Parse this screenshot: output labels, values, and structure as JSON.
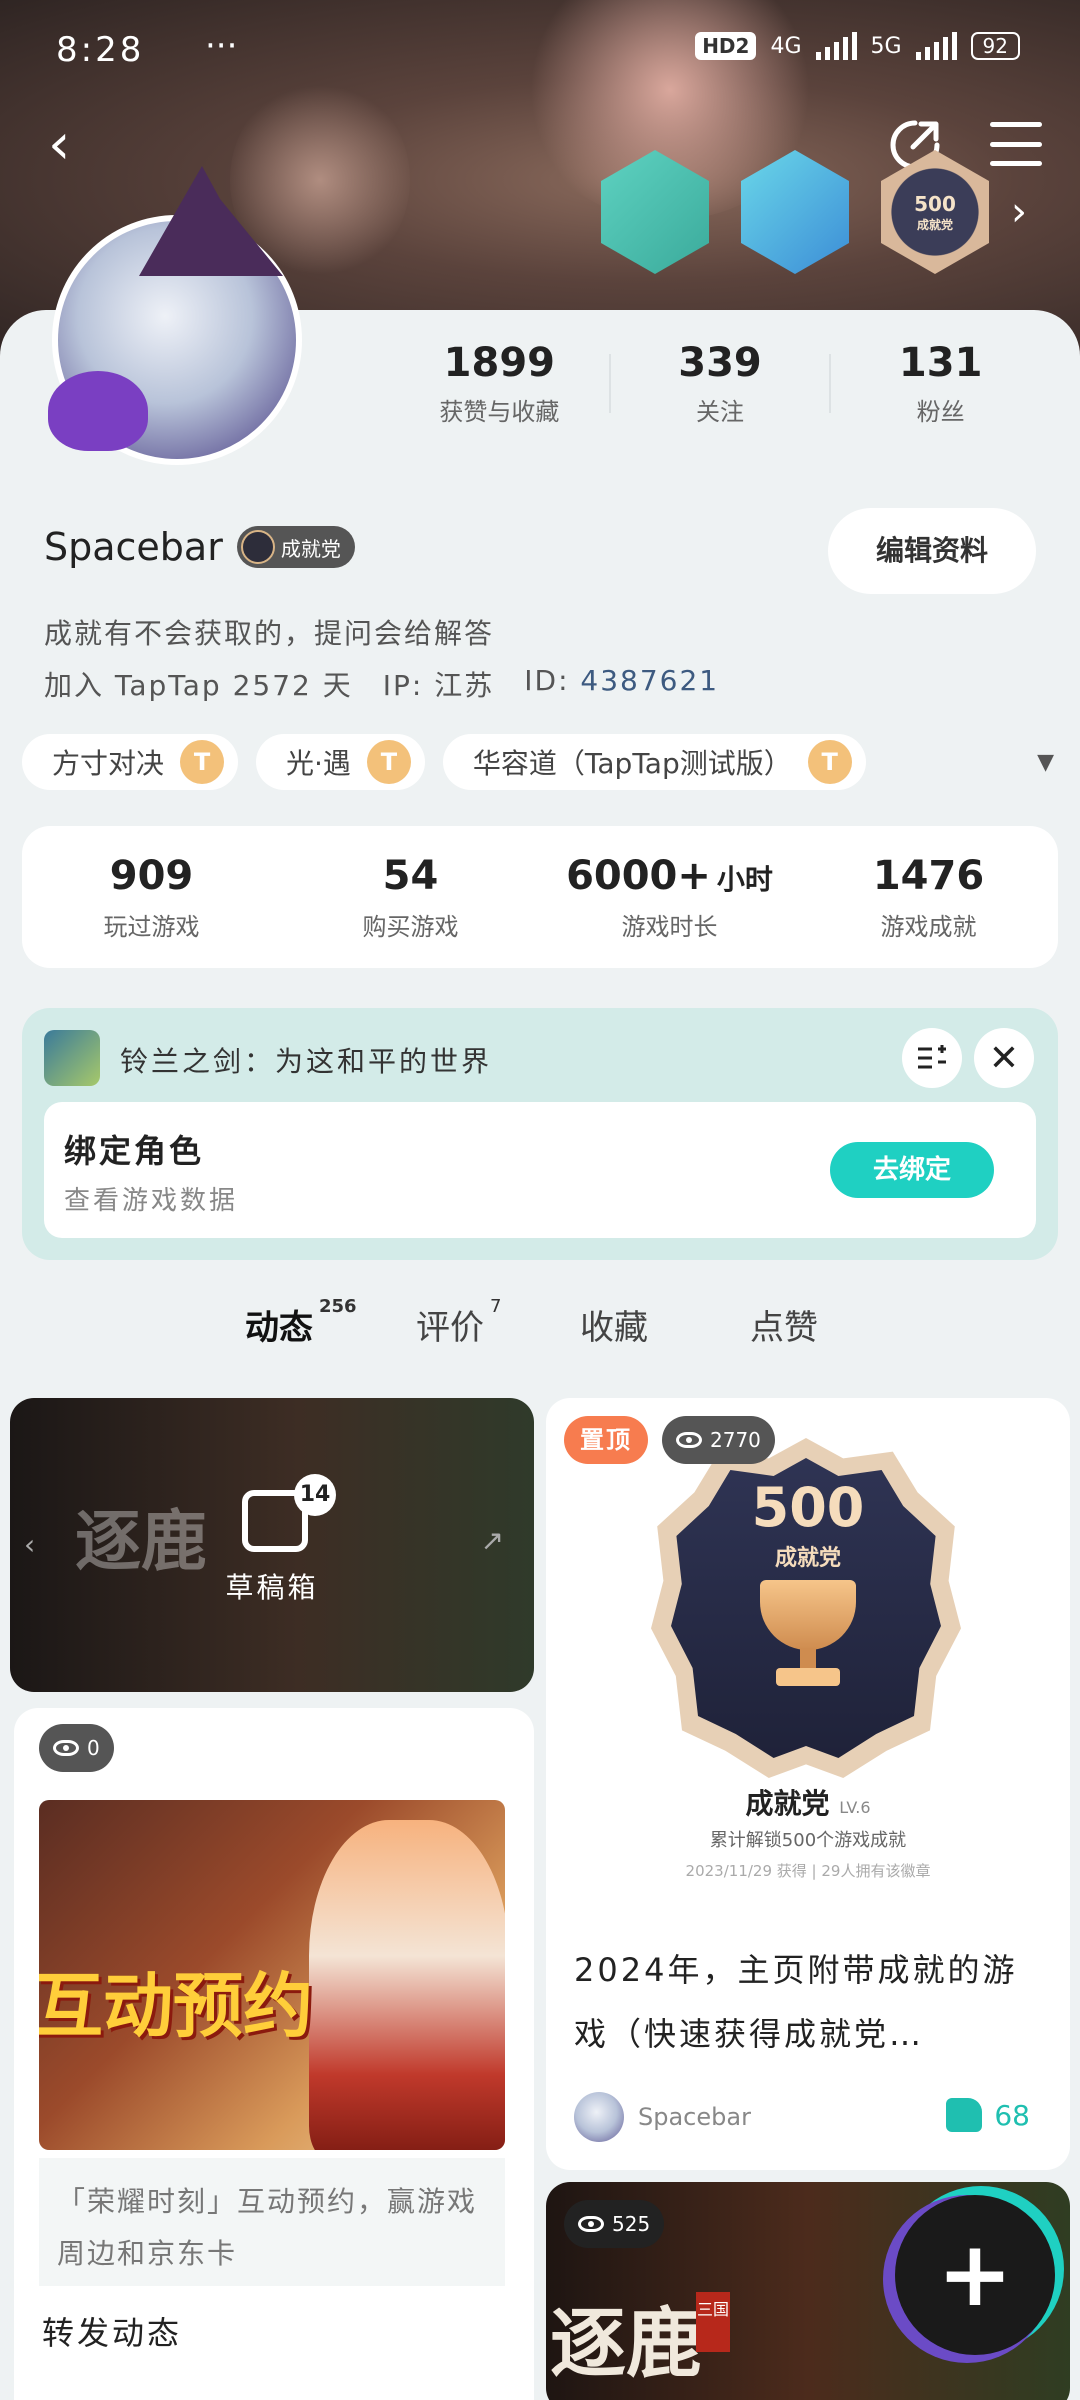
{
  "status_bar": {
    "time": "8:28",
    "dots": "···",
    "hd": "HD2",
    "net1": "4G",
    "net2": "5G",
    "battery": "92"
  },
  "header": {
    "badges": [
      {
        "name": "badge-1",
        "text": ""
      },
      {
        "name": "badge-2",
        "text": ""
      },
      {
        "name": "badge-achievement",
        "num": "500",
        "label": "成就党"
      }
    ]
  },
  "profile": {
    "stats": [
      {
        "num": "1899",
        "label": "获赞与收藏"
      },
      {
        "num": "339",
        "label": "关注"
      },
      {
        "num": "131",
        "label": "粉丝"
      }
    ],
    "username": "Spacebar",
    "title_chip": "成就党",
    "edit_label": "编辑资料",
    "bio": "成就有不会获取的，提问会给解答",
    "joined": "加入 TapTap 2572 天",
    "ip": "IP: 江苏",
    "id_label": "ID:",
    "id_value": "4387621"
  },
  "games": [
    {
      "name": "方寸对决",
      "level": "T"
    },
    {
      "name": "光·遇",
      "level": "T"
    },
    {
      "name": "华容道（TapTap测试版）",
      "level": "T"
    }
  ],
  "game_stats": [
    {
      "num": "909",
      "unit": "",
      "label": "玩过游戏"
    },
    {
      "num": "54",
      "unit": "",
      "label": "购买游戏"
    },
    {
      "num": "6000+",
      "unit": "小时",
      "label": "游戏时长"
    },
    {
      "num": "1476",
      "unit": "",
      "label": "游戏成就"
    }
  ],
  "bind": {
    "game_name": "铃兰之剑：为这和平的世界",
    "title": "绑定角色",
    "subtitle": "查看游戏数据",
    "button": "去绑定"
  },
  "tabs": [
    {
      "label": "动态",
      "count": "256"
    },
    {
      "label": "评价",
      "count": "7"
    },
    {
      "label": "收藏",
      "count": ""
    },
    {
      "label": "点赞",
      "count": ""
    }
  ],
  "feed": {
    "draft": {
      "ghost": "逐鹿",
      "count": "14",
      "label": "草稿箱"
    },
    "repost": {
      "views": "0",
      "poster_text": "互动预约",
      "quote": "「荣耀时刻」互动预约，赢游戏周边和京东卡",
      "title": "转发动态"
    },
    "pinned": {
      "tag": "置顶",
      "views": "2770",
      "badge_num": "500",
      "badge_label": "成就党",
      "ach_name": "成就党",
      "ach_level": "LV.6",
      "ach_desc": "累计解锁500个游戏成就",
      "ach_date": "2023/11/29 获得 | 29人拥有该徽章",
      "title": "2024年，主页附带成就的游戏（快速获得成就党…",
      "author": "Spacebar",
      "likes": "68"
    },
    "video": {
      "views": "525",
      "text": "逐鹿",
      "seal": "三国"
    }
  }
}
